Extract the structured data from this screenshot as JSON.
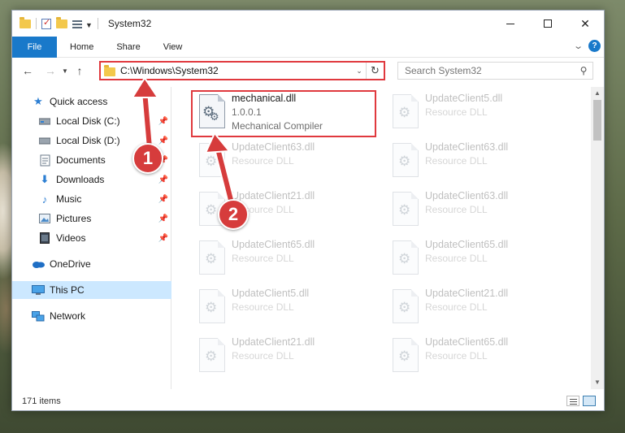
{
  "window": {
    "title": "System32",
    "icons": [
      "folder-icon",
      "checkbox-icon",
      "folder-icon",
      "properties-icon"
    ]
  },
  "ribbon": {
    "tabs": [
      "File",
      "Home",
      "Share",
      "View"
    ],
    "help_label": "?"
  },
  "address": {
    "path": "C:\\Windows\\System32",
    "search_placeholder": "Search System32"
  },
  "nav": {
    "items": [
      {
        "label": "Quick access",
        "icon": "star-icon"
      },
      {
        "label": "Local Disk (C:)",
        "icon": "drive-icon",
        "pinned": true
      },
      {
        "label": "Local Disk (D:)",
        "icon": "drive-icon",
        "pinned": true
      },
      {
        "label": "Documents",
        "icon": "documents-icon",
        "pinned": true
      },
      {
        "label": "Downloads",
        "icon": "download-icon",
        "pinned": true
      },
      {
        "label": "Music",
        "icon": "music-icon",
        "pinned": true
      },
      {
        "label": "Pictures",
        "icon": "pictures-icon",
        "pinned": true
      },
      {
        "label": "Videos",
        "icon": "videos-icon",
        "pinned": true
      },
      {
        "label": "OneDrive",
        "icon": "cloud-icon"
      },
      {
        "label": "This PC",
        "icon": "pc-icon",
        "selected": true
      },
      {
        "label": "Network",
        "icon": "network-icon"
      }
    ]
  },
  "files": {
    "highlighted": {
      "name": "mechanical.dll",
      "version": "1.0.0.1",
      "description": "Mechanical Compiler"
    },
    "left_column": [
      {
        "name": "UpdateClient63.dll",
        "description": "Resource DLL"
      },
      {
        "name": "UpdateClient21.dll",
        "description": "Resource DLL"
      },
      {
        "name": "UpdateClient65.dll",
        "description": "Resource DLL"
      },
      {
        "name": "UpdateClient5.dll",
        "description": "Resource DLL"
      },
      {
        "name": "UpdateClient21.dll",
        "description": "Resource DLL"
      }
    ],
    "right_column": [
      {
        "name": "UpdateClient5.dll",
        "description": "Resource DLL"
      },
      {
        "name": "UpdateClient63.dll",
        "description": "Resource DLL"
      },
      {
        "name": "UpdateClient63.dll",
        "description": "Resource DLL"
      },
      {
        "name": "UpdateClient65.dll",
        "description": "Resource DLL"
      },
      {
        "name": "UpdateClient21.dll",
        "description": "Resource DLL"
      },
      {
        "name": "UpdateClient65.dll",
        "description": "Resource DLL"
      }
    ]
  },
  "status": {
    "item_count": "171 items"
  },
  "annotations": {
    "step1": "1",
    "step2": "2",
    "color": "#d63c3c"
  }
}
